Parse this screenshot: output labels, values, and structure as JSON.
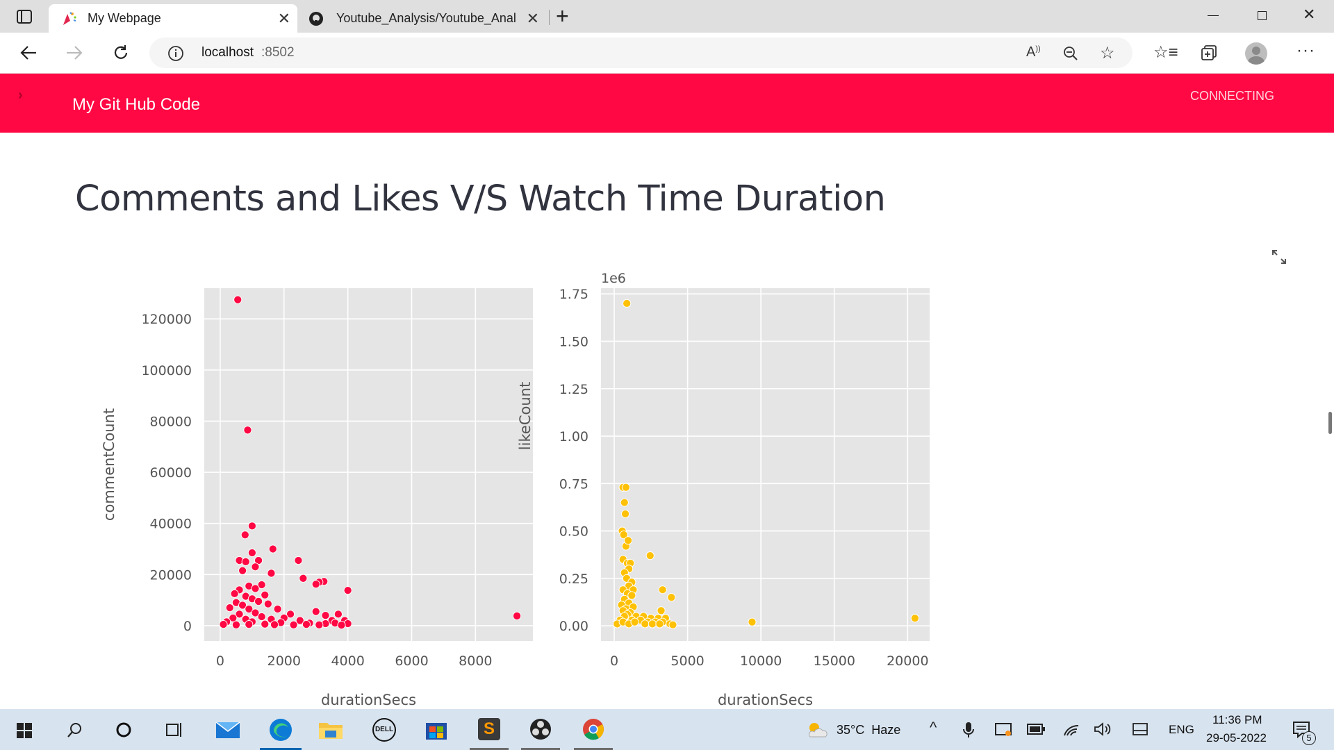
{
  "browser": {
    "tabs": [
      {
        "title": "My Webpage"
      },
      {
        "title": "Youtube_Analysis/Youtube_Analy"
      }
    ],
    "url_host": "localhost",
    "url_port": ":8502"
  },
  "app": {
    "header_link": "My Git Hub Code",
    "status": "CONNECTING",
    "heading": "Comments and Likes V/S Watch Time Duration"
  },
  "chart_data": [
    {
      "type": "scatter",
      "xlabel": "durationSecs",
      "ylabel": "commentCount",
      "color": "#ff0843",
      "xlim": [
        -500,
        9800
      ],
      "ylim": [
        -6000,
        132000
      ],
      "xticks": [
        "0",
        "2000",
        "4000",
        "6000",
        "8000"
      ],
      "xtick_values": [
        0,
        2000,
        4000,
        6000,
        8000
      ],
      "yticks": [
        "0",
        "20000",
        "40000",
        "60000",
        "80000",
        "100000",
        "120000"
      ],
      "ytick_values": [
        0,
        20000,
        40000,
        60000,
        80000,
        100000,
        120000
      ],
      "points": [
        [
          550,
          127500
        ],
        [
          860,
          76500
        ],
        [
          1000,
          39000
        ],
        [
          780,
          35500
        ],
        [
          1650,
          30000
        ],
        [
          2450,
          25500
        ],
        [
          1000,
          28500
        ],
        [
          600,
          25500
        ],
        [
          800,
          25000
        ],
        [
          1200,
          25500
        ],
        [
          1100,
          23000
        ],
        [
          700,
          21500
        ],
        [
          1600,
          20500
        ],
        [
          2600,
          18500
        ],
        [
          3250,
          17300
        ],
        [
          3100,
          17000
        ],
        [
          3000,
          16200
        ],
        [
          1300,
          16000
        ],
        [
          900,
          15500
        ],
        [
          1100,
          14500
        ],
        [
          600,
          14000
        ],
        [
          4000,
          13800
        ],
        [
          450,
          12500
        ],
        [
          1400,
          12000
        ],
        [
          800,
          11500
        ],
        [
          1000,
          10500
        ],
        [
          1200,
          9500
        ],
        [
          500,
          9000
        ],
        [
          1500,
          8500
        ],
        [
          700,
          8000
        ],
        [
          300,
          7000
        ],
        [
          1800,
          6500
        ],
        [
          900,
          6500
        ],
        [
          1100,
          5000
        ],
        [
          2200,
          4500
        ],
        [
          3000,
          5500
        ],
        [
          3700,
          4500
        ],
        [
          3300,
          4000
        ],
        [
          600,
          4500
        ],
        [
          1300,
          3500
        ],
        [
          2000,
          3000
        ],
        [
          400,
          3000
        ],
        [
          800,
          2500
        ],
        [
          1600,
          2500
        ],
        [
          2500,
          2000
        ],
        [
          3500,
          2000
        ],
        [
          3900,
          2000
        ],
        [
          200,
          1500
        ],
        [
          1000,
          1500
        ],
        [
          1900,
          1200
        ],
        [
          2800,
          1000
        ],
        [
          3300,
          800
        ],
        [
          3600,
          1000
        ],
        [
          4000,
          800
        ],
        [
          100,
          500
        ],
        [
          500,
          300
        ],
        [
          900,
          500
        ],
        [
          1400,
          600
        ],
        [
          1700,
          400
        ],
        [
          2300,
          300
        ],
        [
          2700,
          500
        ],
        [
          3100,
          300
        ],
        [
          3800,
          200
        ],
        [
          9300,
          3800
        ]
      ]
    },
    {
      "type": "scatter",
      "xlabel": "durationSecs",
      "ylabel": "likeCount",
      "offset_label": "1e6",
      "color": "#ffc107",
      "xlim": [
        -900,
        21500
      ],
      "ylim": [
        -0.08,
        1.78
      ],
      "xticks": [
        "0",
        "5000",
        "10000",
        "15000",
        "20000"
      ],
      "xtick_values": [
        0,
        5000,
        10000,
        15000,
        20000
      ],
      "yticks": [
        "0.00",
        "0.25",
        "0.50",
        "0.75",
        "1.00",
        "1.25",
        "1.50",
        "1.75"
      ],
      "ytick_values": [
        0,
        0.25,
        0.5,
        0.75,
        1.0,
        1.25,
        1.5,
        1.75
      ],
      "points": [
        [
          860,
          1.7
        ],
        [
          600,
          0.73
        ],
        [
          800,
          0.73
        ],
        [
          700,
          0.65
        ],
        [
          760,
          0.59
        ],
        [
          550,
          0.5
        ],
        [
          650,
          0.48
        ],
        [
          800,
          0.42
        ],
        [
          950,
          0.45
        ],
        [
          2450,
          0.37
        ],
        [
          600,
          0.35
        ],
        [
          900,
          0.33
        ],
        [
          1100,
          0.33
        ],
        [
          1000,
          0.3
        ],
        [
          700,
          0.28
        ],
        [
          850,
          0.25
        ],
        [
          1200,
          0.23
        ],
        [
          1000,
          0.21
        ],
        [
          1300,
          0.19
        ],
        [
          600,
          0.19
        ],
        [
          3300,
          0.19
        ],
        [
          900,
          0.17
        ],
        [
          1200,
          0.16
        ],
        [
          3900,
          0.15
        ],
        [
          700,
          0.14
        ],
        [
          1000,
          0.12
        ],
        [
          500,
          0.11
        ],
        [
          1300,
          0.1
        ],
        [
          800,
          0.09
        ],
        [
          600,
          0.08
        ],
        [
          3200,
          0.08
        ],
        [
          1100,
          0.07
        ],
        [
          900,
          0.06
        ],
        [
          700,
          0.05
        ],
        [
          1500,
          0.05
        ],
        [
          2000,
          0.05
        ],
        [
          2500,
          0.04
        ],
        [
          3000,
          0.04
        ],
        [
          3500,
          0.04
        ],
        [
          400,
          0.03
        ],
        [
          1200,
          0.03
        ],
        [
          1800,
          0.03
        ],
        [
          2300,
          0.02
        ],
        [
          2800,
          0.02
        ],
        [
          3300,
          0.02
        ],
        [
          3800,
          0.01
        ],
        [
          200,
          0.01
        ],
        [
          600,
          0.02
        ],
        [
          1000,
          0.01
        ],
        [
          1400,
          0.02
        ],
        [
          2100,
          0.01
        ],
        [
          2600,
          0.01
        ],
        [
          3100,
          0.01
        ],
        [
          4000,
          0.005
        ],
        [
          9400,
          0.02
        ],
        [
          20500,
          0.04
        ]
      ]
    }
  ],
  "taskbar": {
    "weather": "35°C  Haze",
    "lang": "ENG",
    "time": "11:36 PM",
    "date": "29-05-2022",
    "notif_count": "5"
  }
}
